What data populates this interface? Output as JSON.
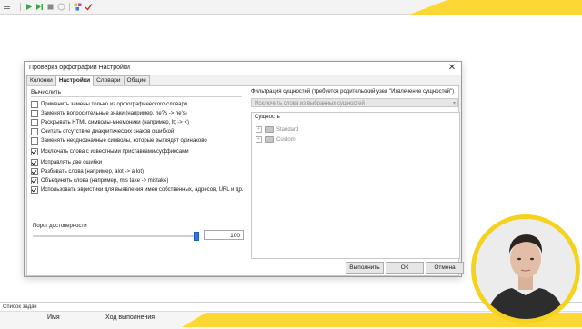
{
  "dialog": {
    "title": "Проверка орфографии Настройки",
    "tabs": [
      {
        "label": "Колонки",
        "active": false
      },
      {
        "label": "Настройки",
        "active": true
      },
      {
        "label": "Словари",
        "active": false
      },
      {
        "label": "Общие",
        "active": false
      }
    ],
    "section_label": "Вычислить",
    "options": [
      {
        "label": "Применить замены только из орфографического словаря",
        "checked": false
      },
      {
        "label": "Заменять вопросительные знаки (например, he?s -> he's)",
        "checked": false
      },
      {
        "label": "Раскрывать HTML символы-мнемоники (например, lt; -> <)",
        "checked": false
      },
      {
        "label": "Считать отсутствие диакритических знаков ошибкой",
        "checked": false
      },
      {
        "label": "Заменять неоднозначные символы, которые выглядят одинаково",
        "checked": false
      },
      {
        "label": "Исключать слова с известными приставками/суффиксами",
        "checked": true
      },
      {
        "label": "Исправлять две ошибки",
        "checked": true
      },
      {
        "label": "Разбивать слова (например, alot -> a lot)",
        "checked": true
      },
      {
        "label": "Объединять слова (например,  mis take -> mistake)",
        "checked": true
      },
      {
        "label": "Использовать эвристики для выявления имен собственных, адресов, URL и др.",
        "checked": true
      }
    ],
    "threshold": {
      "label": "Порог достоверности",
      "value": "100",
      "level_fraction": 0.98
    },
    "filter": {
      "label": "Фильтрация сущностей (требуется родительский узел \"Извлечение сущностей\")",
      "combo_value": "Исключить слова из выбранных сущностей",
      "entity_header": "Сущность",
      "entities": [
        {
          "expander": "+",
          "label": "Standard"
        },
        {
          "expander": "+",
          "label": "Custom"
        }
      ]
    },
    "buttons": {
      "apply": "Выполнить",
      "ok": "ОК",
      "cancel": "Отмена"
    }
  },
  "bottom_panel": {
    "title": "Список задач",
    "columns": [
      "Имя",
      "Ход выполнения"
    ]
  },
  "icons": [
    "close-icon",
    "checkbox-icon",
    "folder-icon",
    "expander-icon",
    "slider-thumb-icon",
    "dropdown-arrow-icon"
  ],
  "colors": {
    "accent_yellow": "#fdd835",
    "slider_blue": "#2f7ad9",
    "dialog_bg": "#f0f0f0"
  }
}
